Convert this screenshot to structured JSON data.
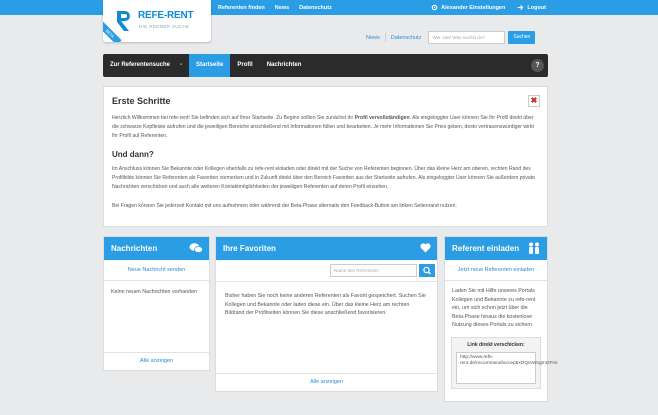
{
  "topbar": {
    "nav": [
      "Referenten finden",
      "News",
      "Datenschutz"
    ],
    "settings": "Alexander Einstellungen",
    "logout": "Logout"
  },
  "logo": {
    "name": "REFE-RENT",
    "tagline": "DIE REDNER SUCHE",
    "badge": "BETA"
  },
  "subbar": {
    "news": "News",
    "privacy": "Datenschutz",
    "search_placeholder": "Wer oder Was suchst du?",
    "search_button": "Suchen"
  },
  "mainnav": {
    "items": [
      "Zur Referentensuche",
      "Startseite",
      "Profil",
      "Nachrichten"
    ],
    "dropdown": "-",
    "help": "?"
  },
  "intro": {
    "title": "Erste Schritte",
    "p1_start": "Herzlich Willkommen bei refe-rent! Sie befinden sich auf Ihrer Startseite. Zu Beginn sollten Sie zunächst ihr ",
    "p1_bold": "Profil vervollständigen",
    "p1_end": ". Als eingeloggter User können Sie Ihr Profil direkt über die schwarze Kopfleiste aufrufen und die jeweiligen Bereiche anschließend mit Informationen füllen und bearbeiten. Je mehr Informationen Sie Preis geben, desto vertrauenswürdiger wirkt Ihr Profil auf Referenten.",
    "subtitle": "Und dann?",
    "p2": "Im Anschluss können Sie Bekannte oder Kollegen ebenfalls zu refe-rent einladen oder direkt mit der Suche von Referenten beginnen. Über das kleine Herz am oberen, rechten Rand des Profilbilds können Sie Referenten als Favoriten vormerken und in Zukunft direkt über den Bereich Favoriten aus der Startseite aufrufen. Als eingeloggter User können Sie außerdem private Nachrichten verschicken und auch alle weiteren Kontaktmöglichkeiten der jeweiligen Referenten auf deren Profil einsehen.",
    "p3": "Bei Fragen können Sie jederzeit Kontakt mit uns aufnehmen oder während der Beta-Phase alternativ den Feedback-Button am linken Seitenrand nutzen."
  },
  "messages": {
    "title": "Nachrichten",
    "action": "Neue Nachricht senden",
    "empty": "Keine neuen Nachrichten vorhanden",
    "footer": "Alle anzeigen"
  },
  "favorites": {
    "title": "Ihre Favoriten",
    "search_placeholder": "Name des Referenten",
    "empty": "Bisher haben Sie noch keine anderen Referenten als Favorit gespeichert. Suchen Sie Kollegen und Bekannte oder laden diese ein. Über das kleine Herz am rechten Bildrand der Profilseiten können Sie diese anschließend favorisieren.",
    "footer": "Alle anzeigen"
  },
  "invite": {
    "title": "Referent einladen",
    "action": "Jetzt neue Referenten einladen",
    "text": "Laden Sie mit Hilfe unseres Portals Kollegen und Bekannte zu refe-rent ein, um sich schon jetzt über die Beta-Phase hinaus die kostenlose Nutzung dieses Portals zu sichern.",
    "share_label": "Link direkt verschicken:",
    "share_link": "http://www.refe-rent.de/recommend/acceptIxDQmWogmGFmi"
  },
  "colors": {
    "accent": "#2a9de4",
    "nav": "#2b2b2b",
    "link": "#2a8dd1",
    "close": "#dd2222"
  }
}
